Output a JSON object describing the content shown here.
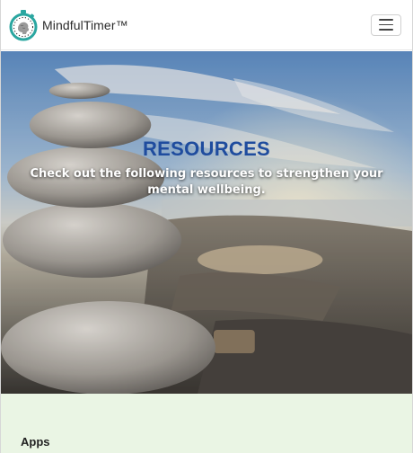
{
  "navbar": {
    "brand_name": "MindfulTimer™",
    "logo_icon": "stopwatch-brain-icon",
    "menu_icon": "hamburger-icon"
  },
  "hero": {
    "title": "RESOURCES",
    "subtitle": "Check out the following resources to strengthen your mental wellbeing."
  },
  "apps": {
    "heading": "Apps"
  },
  "colors": {
    "title_blue": "#1f4c9e",
    "section_green": "#eaf5e4",
    "logo_teal": "#2aa6a0"
  }
}
